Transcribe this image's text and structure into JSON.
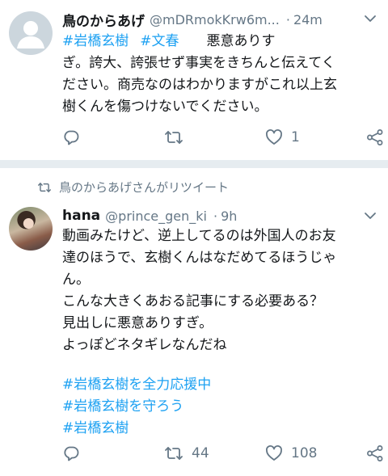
{
  "tweet1": {
    "name": "鳥のからあげ",
    "handle": "@mDRmokKrw6m...",
    "separator": "·",
    "time": "24m",
    "hashtags": [
      "#岩橋玄樹",
      "#文春"
    ],
    "lines": [
      "悪意ありす",
      "ぎ。誇大、誇張せず事実をきちんと伝えてく",
      "ださい。商売なのはわかりますがこれ以上玄",
      "樹くんを傷つけないでください。"
    ],
    "reply_count": "",
    "retweet_count": "",
    "like_count": "1"
  },
  "tweet2": {
    "retweet_label": "鳥のからあげさんがリツイート",
    "name": "hana",
    "handle": "@prince_gen_ki",
    "separator": "·",
    "time": "9h",
    "lines": [
      "動画みたけど、逆上してるのは外国人のお友",
      "達のほうで、玄樹くんはなだめてるほうじゃ",
      "ん。",
      "こんな大きくあおる記事にする必要ある？",
      "見出しに悪意ありすぎ。",
      "よっぽどネタギレなんだね"
    ],
    "hashtags": [
      "#岩橋玄樹を全力応援中",
      "#岩橋玄樹を守ろう",
      "#岩橋玄樹"
    ],
    "reply_count": "",
    "retweet_count": "44",
    "like_count": "108"
  },
  "colors": {
    "link": "#1da1f2",
    "secondary": "#657786",
    "divider": "#e6ecf0"
  },
  "icons": [
    "default-avatar-icon",
    "caret-down-icon",
    "reply-icon",
    "retweet-icon",
    "like-icon",
    "share-icon"
  ]
}
